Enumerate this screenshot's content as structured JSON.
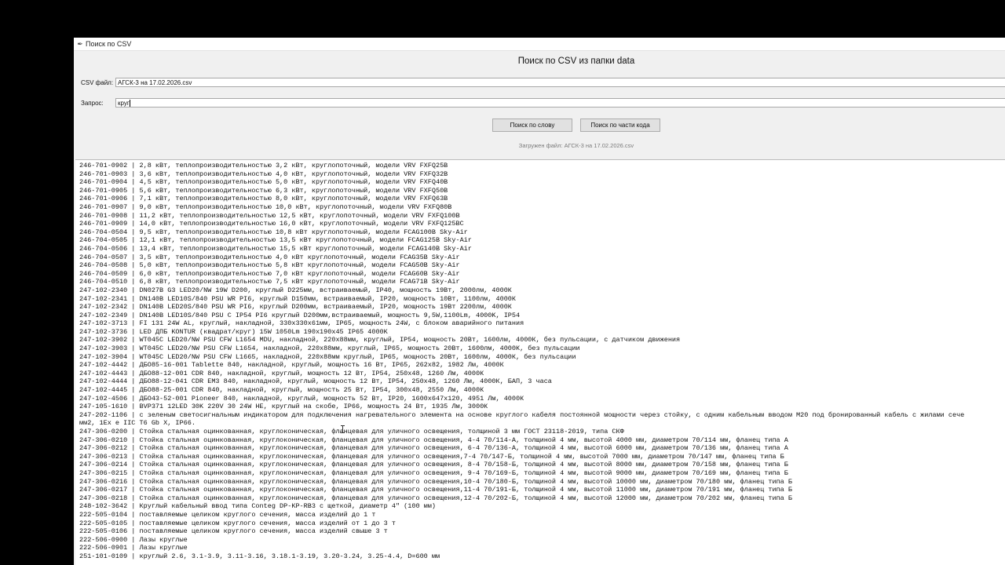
{
  "window": {
    "title": "Поиск по CSV",
    "icon": "feather-icon"
  },
  "header": {
    "title": "Поиск по CSV из папки data"
  },
  "csv_file": {
    "label": "CSV файл:",
    "value": "АГСК-3 на 17.02.2026.csv"
  },
  "query": {
    "label": "Запрос:",
    "value": "круг"
  },
  "buttons": {
    "search_word": "Поиск по слову",
    "search_code": "Поиск по части кода"
  },
  "status": "Загружен файл: АГСК-3 на 17.02.2026.csv",
  "results": [
    "246-701-0902 | 2,8 кВт, теплопроизводительностью 3,2 кВт, круглопоточный, модели VRV FXFQ25B",
    "246-701-0903 | 3,6 кВт, теплопроизводительностью 4,0 кВт, круглопоточный, модели VRV FXFQ32B",
    "246-701-0904 | 4,5 кВт, теплопроизводительностью 5,0 кВт, круглопоточный, модели VRV FXFQ40B",
    "246-701-0905 | 5,6 кВт, теплопроизводительностью 6,3 кВт, круглопоточный, модели VRV FXFQ50B",
    "246-701-0906 | 7,1 кВт, теплопроизводительностью 8,0 кВт, круглопоточный, модели VRV FXFQ63B",
    "246-701-0907 | 9,0 кВт, теплопроизводительностью 10,0 кВт, круглопоточный, модели VRV FXFQ80B",
    "246-701-0908 | 11,2 кВт, теплопроизводительностью 12,5 кВт, круглопоточный, модели VRV FXFQ100B",
    "246-701-0909 | 14,0 кВт, теплопроизводительностью 16,0 кВт, круглопоточный, модели VRV FXFQ125BC",
    "246-704-0504 | 9,5 кВт, теплопроизводительностью 10,8 кВт круглопоточный, модели FCAG100B Sky-Air",
    "246-704-0505 | 12,1 кВт, теплопроизводительностью 13,5 кВт круглопоточный, модели FCAG125B Sky-Air",
    "246-704-0506 | 13,4 кВт, теплопроизводительностью 15,5 кВт круглопоточный, модели FCAG140B Sky-Air",
    "246-704-0507 | 3,5 кВт, теплопроизводительностью 4,0 кВт круглопоточный, модели FCAG35B Sky-Air",
    "246-704-0508 | 5,0 кВт, теплопроизводительностью 5,8 кВт круглопоточный, модели FCAG50B Sky-Air",
    "246-704-0509 | 6,0 кВт, теплопроизводительностью 7,0 кВт круглопоточный, модели FCAG60B Sky-Air",
    "246-704-0510 | 6,8 кВт, теплопроизводительностью 7,5 кВт круглопоточный, модели FCAG71B Sky-Air",
    "247-102-2340 | DN027B G3 LED20/NW 19W D200, круглый D225мм, встраиваемый, IP40, мощность 19Вт, 2000лм, 4000К",
    "247-102-2341 | DN140B LED10S/840 PSU WR PI6, круглый D150мм, встраиваемый, IP20, мощность 10Вт, 1100лм, 4000К",
    "247-102-2342 | DN140B LED20S/840 PSU WR PI6, круглый D200мм, встраиваемый, IP20, мощность 19Вт 2200лм, 4000К",
    "247-102-2349 | DN140B LED10S/840 PSU C IP54 PI6 круглый D200мм,встраиваемый, мощность 9,5W,1100Lm, 4000K, IP54",
    "247-102-3713 | FI 131 24W AL, круглый, накладной, 330x330x61мм, IP65, мощность 24W, с блоком аварийного питания",
    "247-102-3736 | LED ДПБ KONTUR (квадрат/круг) 15W 1050Lm 190x190x45 IP65 4000K",
    "247-102-3902 | WT045C LED20/NW PSU CFW L1654 MDU, накладной, 220x88мм, круглый, IP54, мощность 20Вт, 1600лм, 4000К, без пульсации, с датчиком движения",
    "247-102-3903 | WT045C LED20/NW PSU CFW L1654, накладной, 220x88мм, круглый, IP65, мощность 20Вт, 1600лм, 4000К, без пульсации",
    "247-102-3904 | WT045C LED20/NW PSU CFW L1665, накладной, 220x88мм круглый, IP65, мощность 20Вт, 1600лм, 4000К, без пульсации",
    "247-102-4442 | ДБО85-16-001 Tablette 840, накладной, круглый, мощность 16 Вт, IP65, 262x82, 1982 Лм, 4000К",
    "247-102-4443 | ДБО88-12-001 CDR 840, накладной, круглый, мощность 12 Вт, IP54, 250x48, 1260 Лм, 4000К",
    "247-102-4444 | ДБО88-12-041 CDR EM3 840, накладной, круглый, мощность 12 Вт, IP54, 250x48, 1260 Лм, 4000К, БАП, 3 часа",
    "247-102-4445 | ДБО88-25-001 CDR 840, накладной, круглый, мощность 25 Вт, IP54, 300x48, 2550 Лм, 4000К",
    "247-102-4506 | ДБО43-52-001 Pioneer 840, накладной, круглый, мощность 52 Вт, IP20, 1600x647x120, 4951 Лм, 4000К",
    "247-105-1610 | BVP371 12LED 30K 220V 30 24W HE, круглый на скобе, IP66, мощность 24 Вт, 1935 Лм, 3000К",
    "247-202-1106 | с зеленым светосигнальным индикатором для подключения нагревательного элемента на основе круглого кабеля постоянной мощности через стойку, с одним кабельным вводом M20 под бронированный кабель с жилами сече",
    "мм2, 1Ex e IIC T6 Gb X, IP66.",
    "247-306-0200 | Стойка стальная оцинкованная, круглоконическая, фланцевая для уличного освещения, толщиной 3 мм ГОСТ 23118-2019, типа СКФ",
    "247-306-0210 | Стойка стальная оцинкованная, круглоконическая, фланцевая для уличного освещения, 4-4 70/114-А, толщиной 4 мм, высотой 4000 мм, диаметром 70/114 мм, фланец типа А",
    "247-306-0212 | Стойка стальная оцинкованная, круглоконическая, фланцевая для уличного освещения, 6-4 70/136-А, толщиной 4 мм, высотой 6000 мм, диаметром 70/136 мм, фланец типа А",
    "247-306-0213 | Стойка стальная оцинкованная, круглоконическая, фланцевая для уличного освещения,7-4 70/147-Б, толщиной 4 мм, высотой 7000 мм, диаметром 70/147 мм, фланец типа Б",
    "247-306-0214 | Стойка стальная оцинкованная, круглоконическая, фланцевая для уличного освещения, 8-4 70/158-Б, толщиной 4 мм, высотой 8000 мм, диаметром 70/158 мм, фланец типа Б",
    "247-306-0215 | Стойка стальная оцинкованная, круглоконическая, фланцевая для уличного освещения, 9-4 70/169-Б, толщиной 4 мм, высотой 9000 мм, диаметром 70/169 мм, фланец типа Б",
    "247-306-0216 | Стойка стальная оцинкованная, круглоконическая, фланцевая для уличного освещения,10-4 70/180-Б, толщиной 4 мм, высотой 10000 мм, диаметром 70/180 мм, фланец типа Б",
    "247-306-0217 | Стойка стальная оцинкованная, круглоконическая, фланцевая для уличного освещения,11-4 70/191-Б, толщиной 4 мм, высотой 11000 мм, диаметром 70/191 мм, фланец типа Б",
    "247-306-0218 | Стойка стальная оцинкованная, круглоконическая, фланцевая для уличного освещения,12-4 70/202-Б, толщиной 4 мм, высотой 12000 мм, диаметром 70/202 мм, фланец типа Б",
    "248-102-3642 | Круглый кабельный ввод типа Conteg DP-KP-RB3 с щеткой, диаметр 4\" (100 мм)",
    "222-505-0104 | поставляемые целиком круглого сечения, масса изделий до 1 т",
    "222-505-0105 | поставляемые целиком круглого сечения, масса изделий от 1 до 3 т",
    "222-505-0106 | поставляемые целиком круглого сечения, масса изделий свыше 3 т",
    "222-506-0900 | Лазы круглые",
    "222-506-0901 | Лазы круглые",
    "251-101-0109 | круглый 2.6, 3.1-3.9, 3.11-3.16, 3.18.1-3.19, 3.20-3.24, 3.25-4.4, D=600 мм"
  ]
}
